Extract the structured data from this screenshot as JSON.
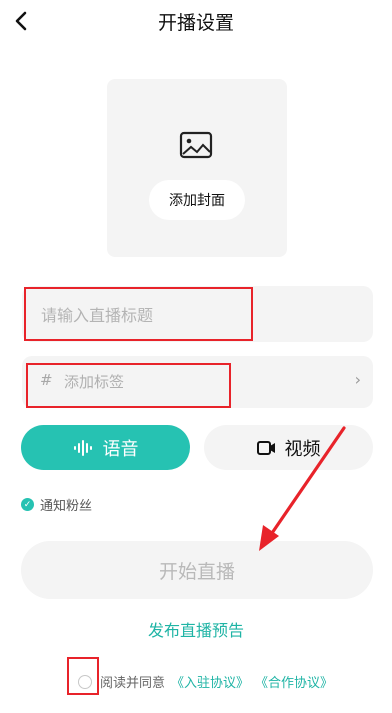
{
  "header": {
    "title": "开播设置",
    "back_icon": "chevron-left-icon"
  },
  "cover": {
    "icon": "image-icon",
    "button_label": "添加封面"
  },
  "title_input": {
    "placeholder": "请输入直播标题",
    "value": ""
  },
  "tags": {
    "hash": "#",
    "label": "添加标签",
    "chevron": "›"
  },
  "mode": {
    "voice": {
      "label": "语音",
      "icon": "soundwave-icon",
      "selected": true
    },
    "video": {
      "label": "视频",
      "icon": "video-camera-icon",
      "selected": false
    }
  },
  "notify": {
    "label": "通知粉丝",
    "checked": true
  },
  "start_button": {
    "label": "开始直播"
  },
  "preview_link": {
    "label": "发布直播预告"
  },
  "agreement": {
    "prefix": "阅读并同意",
    "link1": "《入驻协议》",
    "link2": "《合作协议》",
    "checked": false
  },
  "colors": {
    "accent": "#26c2b2",
    "annotation_red": "#e8232a",
    "field_bg": "#f4f4f4"
  }
}
